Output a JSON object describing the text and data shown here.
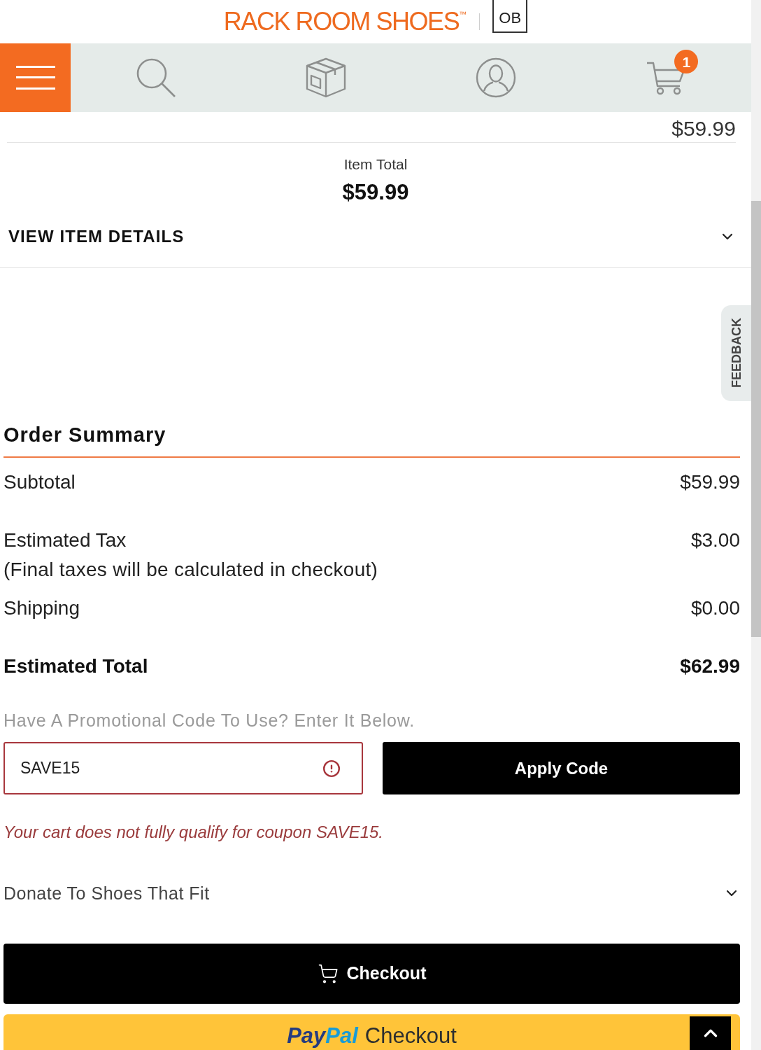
{
  "header": {
    "logo": "RACK ROOM SHOES$^{™}$",
    "badge": "OB"
  },
  "nav": {
    "items": [
      {
        "kind": "menu"
      },
      {
        "kind": "search"
      },
      {
        "kind": "orders"
      },
      {
        "kind": "account"
      },
      {
        "kind": "cart",
        "badge": "1"
      }
    ]
  },
  "item": {
    "price": "$59.99",
    "total_label": "Item Total",
    "total": "$59.99",
    "details_toggle": {
      "label": "VIEW ITEM DETAILS",
      "expanded": false
    }
  },
  "feedback_tab": {
    "label": "FEEDBACK"
  },
  "order_summary": {
    "title": "Order Summary",
    "rows": [
      {
        "label": "Subtotal",
        "value": "$59.99"
      },
      {
        "label": "Estimated Tax",
        "note": "(Final taxes will be calculated in checkout)",
        "value": "$3.00"
      },
      {
        "label": "Shipping",
        "value": "$0.00"
      }
    ],
    "total": {
      "label": "Estimated Total",
      "value": "$62.99"
    }
  },
  "promo": {
    "prompt": "Have A Promotional Code To Use? Enter It Below.",
    "value": "SAVE15",
    "invalid": true,
    "button": "Apply Code",
    "error": "Your cart does not fully qualify for coupon SAVE15."
  },
  "donate": {
    "label": "Donate To Shoes That Fit",
    "expanded": false
  },
  "checkout_button": {
    "label": "Checkout"
  },
  "paypal_button": {
    "logo_parts": [
      "Pay",
      "Pal"
    ],
    "label": "Checkout"
  }
}
